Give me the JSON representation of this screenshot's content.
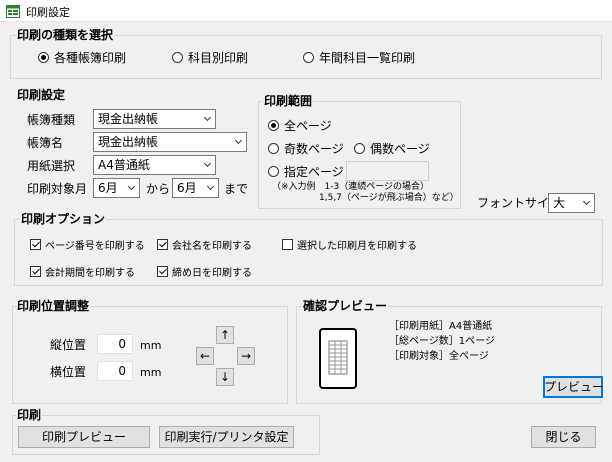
{
  "window": {
    "title": "印刷設定"
  },
  "type_group": {
    "legend": "印刷の種類を選択",
    "options": [
      "各種帳簿印刷",
      "科目別印刷",
      "年間科目一覧印刷"
    ],
    "selected": "各種帳簿印刷"
  },
  "settings": {
    "legend": "印刷設定",
    "book_type_label": "帳簿種類",
    "book_type_value": "現金出納帳",
    "book_name_label": "帳簿名",
    "book_name_value": "現金出納帳",
    "paper_label": "用紙選択",
    "paper_value": "A4普通紙",
    "month_label": "印刷対象月",
    "month_from": "6月",
    "month_from_word": "から",
    "month_to": "6月",
    "month_to_word": "まで"
  },
  "range": {
    "legend": "印刷範囲",
    "all": "全ページ",
    "odd": "奇数ページ",
    "even": "偶数ページ",
    "specify": "指定ページ",
    "specify_value": "",
    "note_line1": "（※入力例　1-3（連続ページの場合）",
    "note_line2": "1,5,7（ページが飛ぶ場合）など）"
  },
  "font_size": {
    "label": "フォントサイズ",
    "value": "大"
  },
  "options": {
    "legend": "印刷オプション",
    "page_number": "ページ番号を印刷する",
    "company_name": "会社名を印刷する",
    "selected_month": "選択した印刷月を印刷する",
    "fiscal_period": "会計期間を印刷する",
    "closing_date": "締め日を印刷する",
    "checked": {
      "page_number": true,
      "company_name": true,
      "selected_month": false,
      "fiscal_period": true,
      "closing_date": true
    }
  },
  "position": {
    "legend": "印刷位置調整",
    "vertical_label": "縦位置",
    "vertical_value": "0",
    "horizontal_label": "横位置",
    "horizontal_value": "0",
    "unit": "mm",
    "up": "↑",
    "down": "↓",
    "left": "←",
    "right": "→"
  },
  "preview": {
    "legend": "確認プレビュー",
    "paper_info": "［印刷用紙］A4普通紙",
    "pages_info": "［総ページ数］1ページ",
    "target_info": "［印刷対象］全ページ",
    "button": "プレビュー"
  },
  "print": {
    "legend": "印刷",
    "preview_button": "印刷プレビュー",
    "execute_button": "印刷実行/プリンタ設定"
  },
  "close_button": "閉じる"
}
